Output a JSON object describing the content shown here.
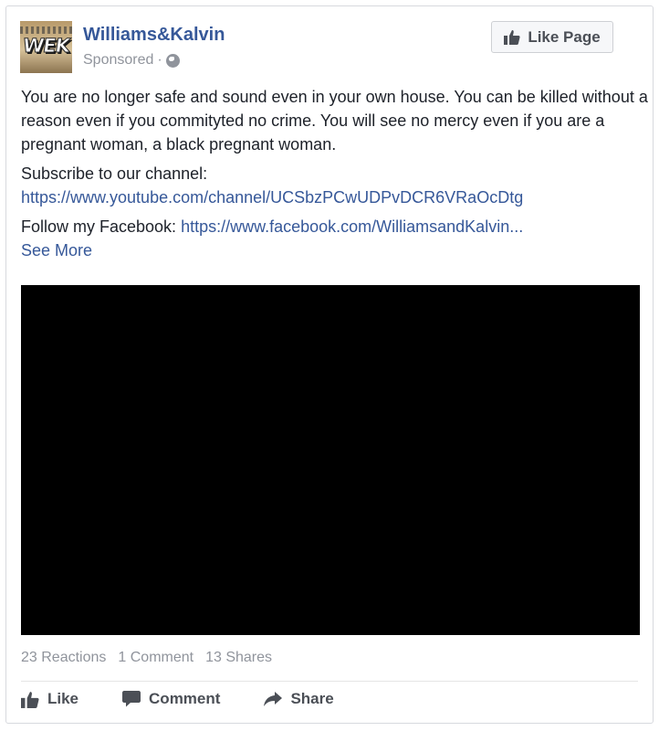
{
  "post": {
    "page_name": "Williams&Kalvin",
    "sponsored_label": "Sponsored",
    "separator": "·",
    "avatar_text": "WEK",
    "like_page_label": "Like Page",
    "paragraphs": {
      "main": "You are no longer safe and sound even in your own house. You can be killed without a reason even if you commityted no crime. You will see no mercy even if you are a pregnant woman, a black pregnant woman.",
      "subscribe_label": "Subscribe to our channel:",
      "subscribe_link": "https://www.youtube.com/channel/UCSbzPCwUDPvDCR6VRaOcDtg",
      "follow_label": "Follow my Facebook: ",
      "follow_link": "https://www.facebook.com/WilliamsandKalvin...",
      "see_more": "See More"
    },
    "stats": {
      "reactions": "23 Reactions",
      "comments": "1 Comment",
      "shares": "13 Shares"
    },
    "actions": {
      "like": "Like",
      "comment": "Comment",
      "share": "Share"
    },
    "colors": {
      "link": "#365899",
      "muted": "#90949c",
      "video_bg": "#000000"
    },
    "icons": {
      "globe": "globe-icon",
      "like_page": "thumbs-up-icon",
      "like": "thumbs-up-icon",
      "comment": "speech-bubble-icon",
      "share": "share-arrow-icon"
    }
  }
}
